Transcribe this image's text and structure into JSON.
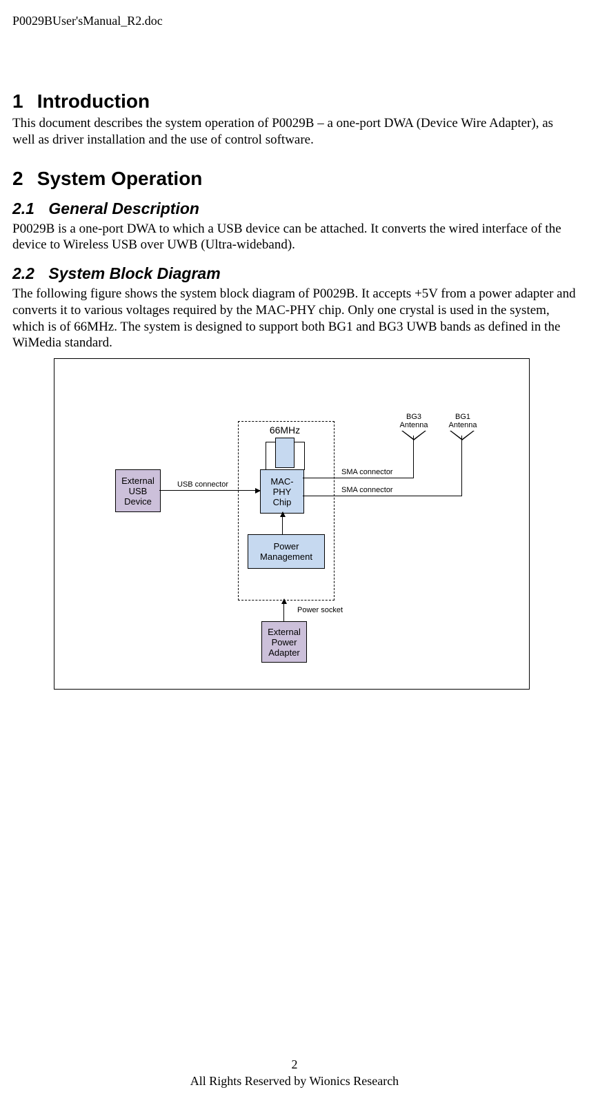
{
  "header_file": "P0029BUser'sManual_R2.doc",
  "section1": {
    "num": "1",
    "title": "Introduction"
  },
  "para1": "This document describes the system operation of P0029B – a one-port DWA (Device Wire Adapter), as well as driver installation and the use of control software.",
  "section2": {
    "num": "2",
    "title": "System Operation"
  },
  "sub21": {
    "num": "2.1",
    "title": "General Description"
  },
  "para21": "P0029B is a one-port DWA to which a USB device can be attached. It converts the wired interface of the device to Wireless USB over UWB (Ultra-wideband).",
  "sub22": {
    "num": "2.2",
    "title": "System Block Diagram"
  },
  "para22": "The following figure shows the system block diagram of P0029B. It accepts +5V from a power adapter and converts it to various voltages required by the MAC-PHY chip. Only one crystal is used in the system, which is of 66MHz. The system is designed to support both BG1 and BG3 UWB bands as defined in the WiMedia standard.",
  "diagram": {
    "crystal_freq": "66MHz",
    "mac_phy": "MAC-\nPHY\nChip",
    "power_mgmt": "Power\nManagement",
    "ext_usb": "External\nUSB\nDevice",
    "ext_power": "External\nPower\nAdapter",
    "usb_connector": "USB connector",
    "sma_connector1": "SMA connector",
    "sma_connector2": "SMA connector",
    "power_socket": "Power socket",
    "bg3": "BG3\nAntenna",
    "bg1": "BG1\nAntenna"
  },
  "footer": {
    "page_num": "2",
    "copyright": "All Rights Reserved by Wionics Research"
  }
}
